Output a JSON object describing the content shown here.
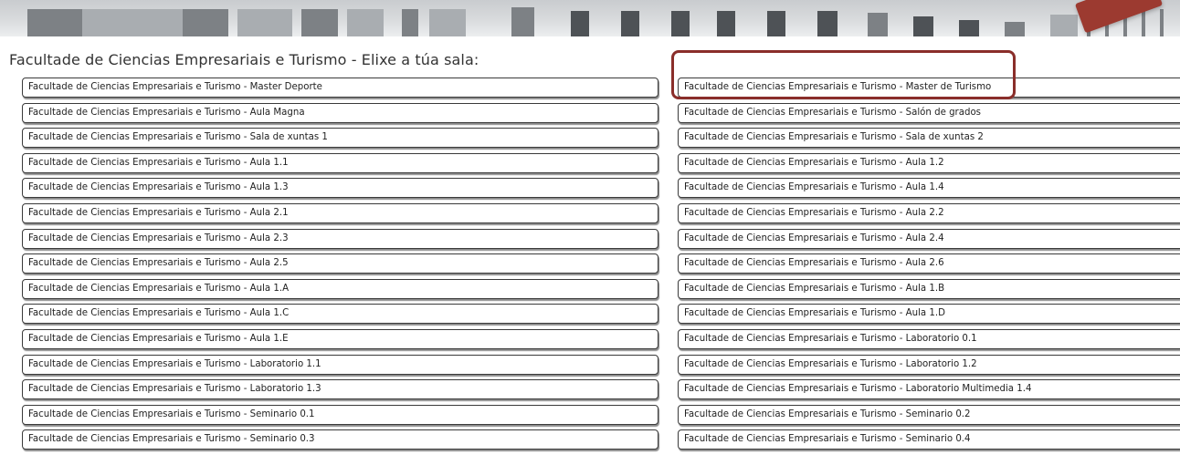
{
  "heading": "Facultade de Ciencias Empresariais e Turismo - Elixe a túa sala:",
  "colors": {
    "highlight": "#8a2e2a",
    "arrow": "#9c3a30"
  },
  "rooms_left": [
    "Facultade de Ciencias Empresariais e Turismo - Master Deporte",
    "Facultade de Ciencias Empresariais e Turismo - Aula Magna",
    "Facultade de Ciencias Empresariais e Turismo - Sala de xuntas 1",
    "Facultade de Ciencias Empresariais e Turismo - Aula 1.1",
    "Facultade de Ciencias Empresariais e Turismo - Aula 1.3",
    "Facultade de Ciencias Empresariais e Turismo - Aula 2.1",
    "Facultade de Ciencias Empresariais e Turismo - Aula 2.3",
    "Facultade de Ciencias Empresariais e Turismo - Aula 2.5",
    "Facultade de Ciencias Empresariais e Turismo - Aula 1.A",
    "Facultade de Ciencias Empresariais e Turismo - Aula 1.C",
    "Facultade de Ciencias Empresariais e Turismo - Aula 1.E",
    "Facultade de Ciencias Empresariais e Turismo - Laboratorio 1.1",
    "Facultade de Ciencias Empresariais e Turismo - Laboratorio 1.3",
    "Facultade de Ciencias Empresariais e Turismo - Seminario 0.1",
    "Facultade de Ciencias Empresariais e Turismo - Seminario 0.3"
  ],
  "rooms_right": [
    "Facultade de Ciencias Empresariais e Turismo - Master de Turismo",
    "Facultade de Ciencias Empresariais e Turismo - Salón de grados",
    "Facultade de Ciencias Empresariais e Turismo - Sala de xuntas 2",
    "Facultade de Ciencias Empresariais e Turismo - Aula 1.2",
    "Facultade de Ciencias Empresariais e Turismo - Aula 1.4",
    "Facultade de Ciencias Empresariais e Turismo - Aula 2.2",
    "Facultade de Ciencias Empresariais e Turismo - Aula 2.4",
    "Facultade de Ciencias Empresariais e Turismo - Aula 2.6",
    "Facultade de Ciencias Empresariais e Turismo - Aula 1.B",
    "Facultade de Ciencias Empresariais e Turismo - Aula 1.D",
    "Facultade de Ciencias Empresariais e Turismo - Laboratorio 0.1",
    "Facultade de Ciencias Empresariais e Turismo - Laboratorio 1.2",
    "Facultade de Ciencias Empresariais e Turismo - Laboratorio Multimedia 1.4",
    "Facultade de Ciencias Empresariais e Turismo - Seminario 0.2",
    "Facultade de Ciencias Empresariais e Turismo - Seminario 0.4"
  ]
}
